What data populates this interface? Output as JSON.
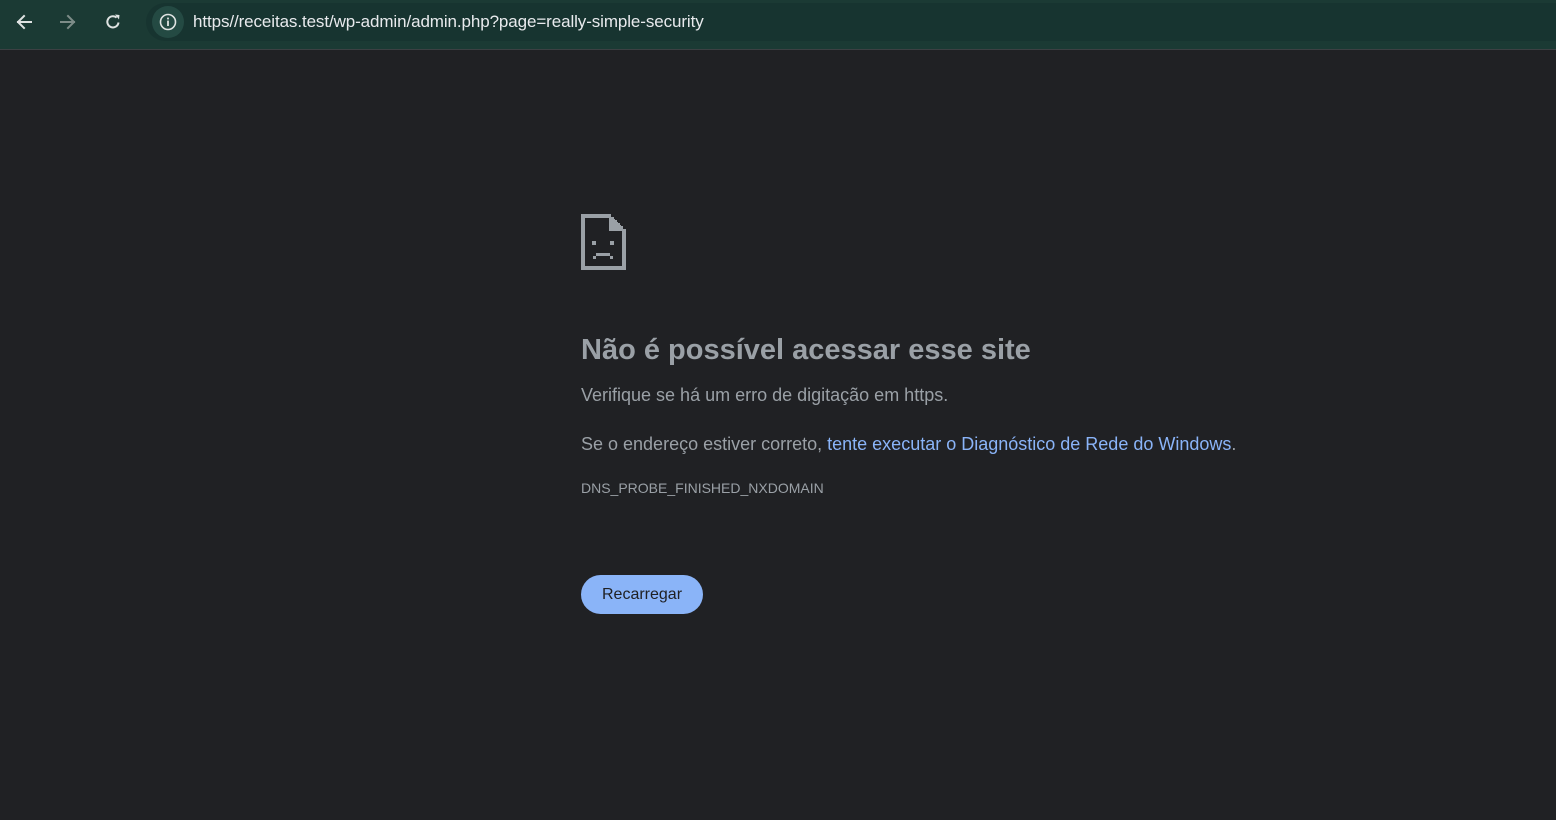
{
  "browser": {
    "url": "https//receitas.test/wp-admin/admin.php?page=really-simple-security",
    "back_icon": "arrow-left-icon",
    "forward_icon": "arrow-right-icon",
    "reload_icon": "reload-icon",
    "site_info_icon": "info-icon"
  },
  "error_page": {
    "icon": "sad-page-icon",
    "title": "Não é possível acessar esse site",
    "message1": "Verifique se há um erro de digitação em https.",
    "message2_prefix": "Se o endereço estiver correto, ",
    "message2_link": "tente executar o Diagnóstico de Rede do Windows",
    "message2_suffix": ".",
    "error_code": "DNS_PROBE_FINISHED_NXDOMAIN",
    "reload_button": "Recarregar"
  },
  "colors": {
    "toolbar": "#1b3a34",
    "page_background": "#202124",
    "link": "#8ab4f8",
    "button": "#8ab4f8",
    "text": "#9aa0a6"
  }
}
